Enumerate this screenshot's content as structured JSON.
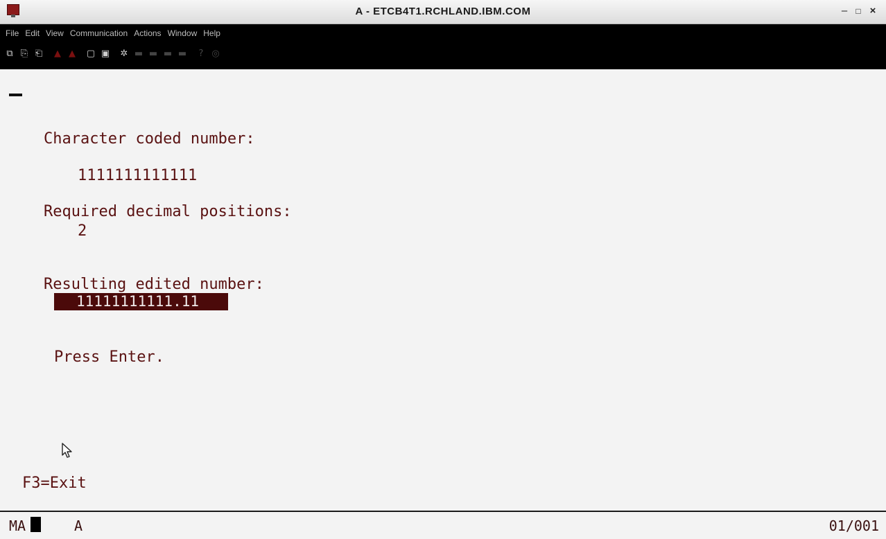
{
  "window": {
    "title": "A - ETCB4T1.RCHLAND.IBM.COM",
    "controls": {
      "minimize": "–",
      "maximize": "□",
      "close": "×"
    }
  },
  "menu": [
    "File",
    "Edit",
    "View",
    "Communication",
    "Actions",
    "Window",
    "Help"
  ],
  "toolbar_icons": [
    "copy-screen-icon",
    "copy-icon",
    "paste-icon",
    "send-icon",
    "receive-icon",
    "display-icon",
    "print-screen-icon",
    "macro-icon",
    "record-icon",
    "stop-icon",
    "play-icon",
    "pause-icon",
    "customize-icon",
    "help-icon"
  ],
  "terminal": {
    "label_character": "Character coded number:",
    "value_character": "1111111111111",
    "label_decimals": "Required decimal positions:",
    "value_decimals": "2",
    "label_result": "Resulting edited number:",
    "value_result": "11111111111.11",
    "instruction": "Press Enter.",
    "fkey": "F3=Exit"
  },
  "status": {
    "mode": "MA",
    "indicator": "A",
    "cursor_position": "01/001"
  },
  "colors": {
    "text": "#5a1212",
    "highlight_bg": "#4b0a0a",
    "menu_bg": "#000000",
    "screen_bg": "#f3f3f3"
  }
}
